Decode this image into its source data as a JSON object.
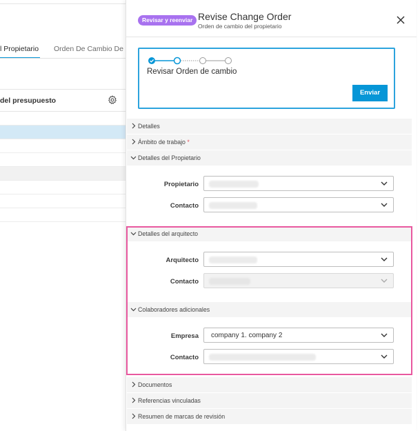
{
  "background": {
    "tabs": [
      {
        "label": "l Propietario"
      },
      {
        "label": "Orden De Cambio De Pro"
      }
    ],
    "table_header": {
      "label": "del presupuesto",
      "settings_icon": "gear-icon"
    }
  },
  "drawer": {
    "badge": "Revisar y reenviar",
    "title": "Revise Change Order",
    "subtitle": "Orden de cambio del propietario",
    "close_icon": "close-icon",
    "workflow": {
      "step_title": "Revisar Orden de cambio",
      "current_step": 2,
      "total_steps": 4,
      "send_label": "Enviar"
    },
    "sections": {
      "detalles": "Detalles",
      "ambito": "Ámbito de trabajo",
      "ambito_required": "*",
      "propietario": "Detalles del Propietario",
      "arquitecto": "Detalles del arquitecto",
      "colaboradores": "Colaboradores adicionales",
      "documentos": "Documentos",
      "referencias": "Referencias vinculadas",
      "marcas": "Resumen de marcas de revisión"
    },
    "fields": {
      "propietario_label": "Propietario",
      "propietario_contacto_label": "Contacto",
      "arquitecto_label": "Arquitecto",
      "arquitecto_contacto_label": "Contacto",
      "empresa_label": "Empresa",
      "empresa_value": "company 1. company 2",
      "colab_contacto_label": "Contacto"
    }
  },
  "colors": {
    "accent": "#0696d7",
    "badge": "#a872ef",
    "highlight": "#e8589f",
    "selected_row": "#d3e9f6"
  }
}
